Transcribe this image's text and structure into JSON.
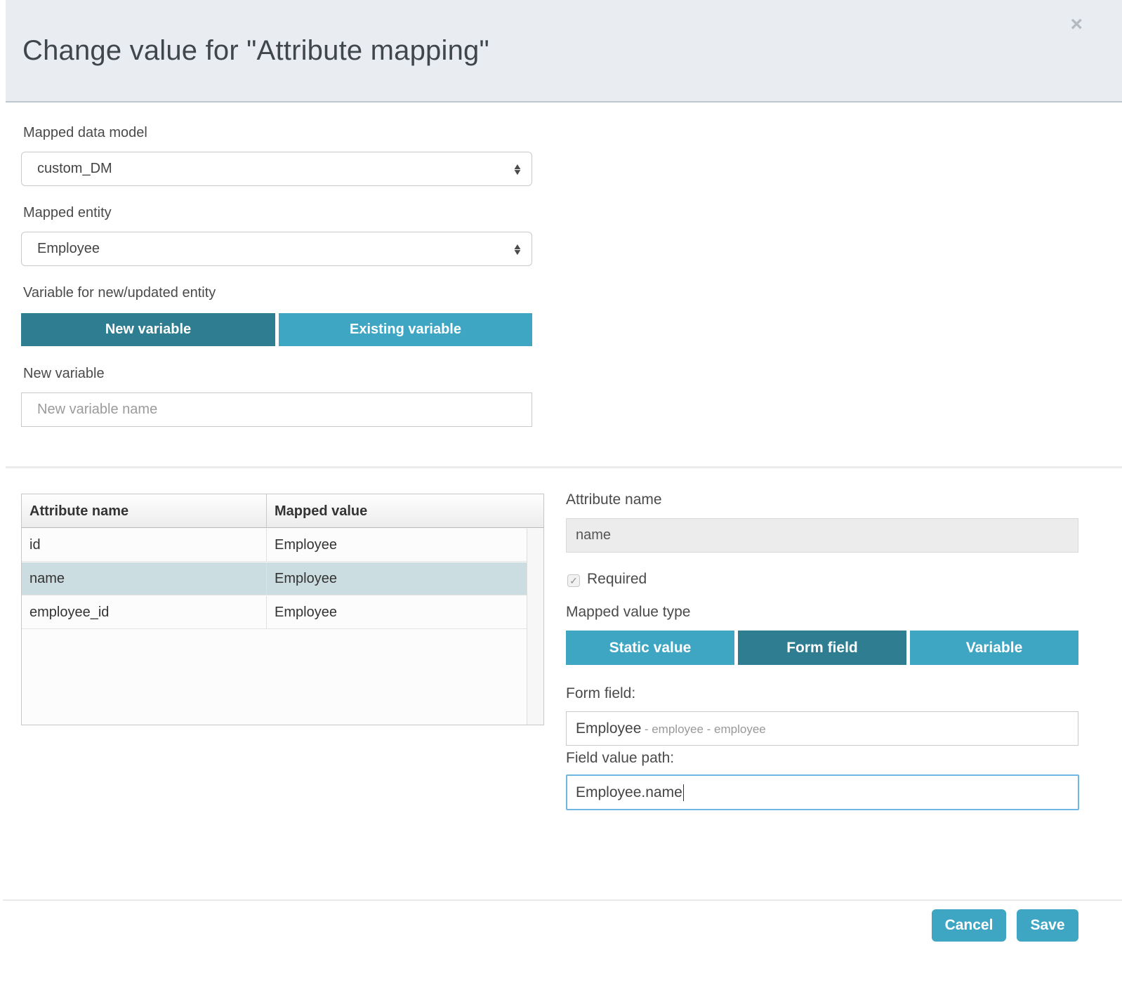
{
  "dialog": {
    "title": "Change value for \"Attribute mapping\"",
    "close_icon": "×"
  },
  "form": {
    "mapped_data_model": {
      "label": "Mapped data model",
      "value": "custom_DM"
    },
    "mapped_entity": {
      "label": "Mapped entity",
      "value": "Employee"
    },
    "variable_toggle": {
      "label": "Variable for new/updated entity",
      "options": [
        "New variable",
        "Existing variable"
      ],
      "selected": "New variable"
    },
    "new_variable": {
      "label": "New variable",
      "value": "",
      "placeholder": "New variable name"
    }
  },
  "table": {
    "columns": [
      "Attribute name",
      "Mapped value"
    ],
    "rows": [
      {
        "attribute": "id",
        "mapped": "Employee",
        "selected": false
      },
      {
        "attribute": "name",
        "mapped": "Employee",
        "selected": true
      },
      {
        "attribute": "employee_id",
        "mapped": "Employee",
        "selected": false
      }
    ]
  },
  "detail": {
    "attribute_name": {
      "label": "Attribute name",
      "value": "name",
      "disabled": true
    },
    "required": {
      "label": "Required",
      "checked": true,
      "check_glyph": "✓"
    },
    "mapped_value_type": {
      "label": "Mapped value type",
      "options": [
        "Static value",
        "Form field",
        "Variable"
      ],
      "selected": "Form field"
    },
    "form_field": {
      "label": "Form field:",
      "value_primary": "Employee",
      "value_secondary": "- employee - employee"
    },
    "field_value_path": {
      "label": "Field value path:",
      "value": "Employee.name",
      "focused": true
    }
  },
  "footer": {
    "cancel_label": "Cancel",
    "save_label": "Save"
  },
  "colors": {
    "accent_dark": "#2e7d91",
    "accent_light": "#3ea6c3",
    "header_bg": "#e9edf1",
    "selected_row": "#cbdde1",
    "focus_border": "#6fb6e2"
  }
}
